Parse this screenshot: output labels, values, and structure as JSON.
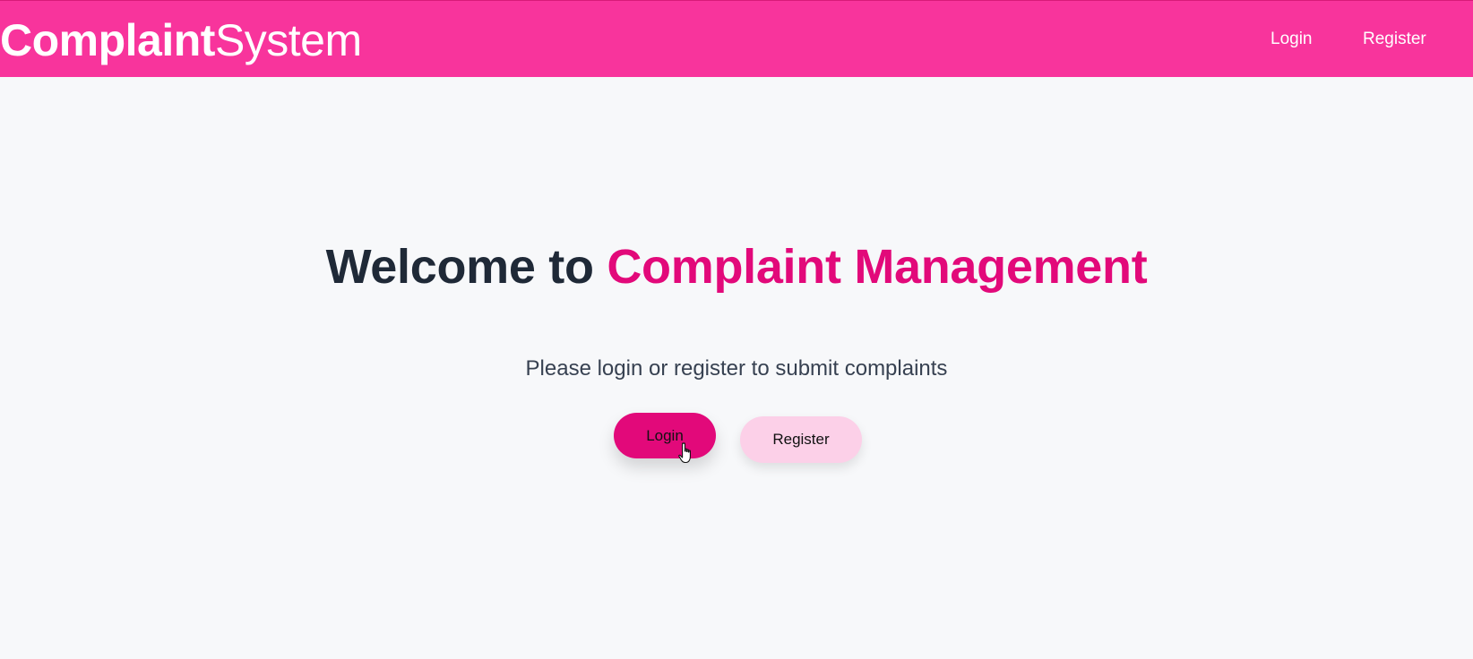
{
  "navbar": {
    "brand_bold": "Complaint",
    "brand_light": "System",
    "links": [
      {
        "label": "Login"
      },
      {
        "label": "Register"
      }
    ]
  },
  "hero": {
    "title_prefix": "Welcome to ",
    "title_accent": "Complaint Management",
    "subtitle": "Please login or register to submit complaints"
  },
  "actions": {
    "login_label": "Login",
    "register_label": "Register"
  },
  "colors": {
    "navbar_bg": "#f8349c",
    "accent": "#e2097a",
    "secondary_button_bg": "#fcd0e8",
    "title_text": "#1f2937",
    "page_bg": "#f7f8fa"
  },
  "icons": {
    "pointer": "hand-pointer-cursor-icon"
  }
}
